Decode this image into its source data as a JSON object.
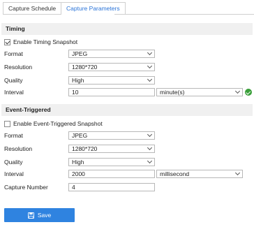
{
  "tabs": [
    {
      "label": "Capture Schedule",
      "active": false
    },
    {
      "label": "Capture Parameters",
      "active": true
    }
  ],
  "timing": {
    "title": "Timing",
    "enable_label": "Enable Timing Snapshot",
    "enabled": true,
    "format": {
      "label": "Format",
      "value": "JPEG"
    },
    "resolution": {
      "label": "Resolution",
      "value": "1280*720"
    },
    "quality": {
      "label": "Quality",
      "value": "High"
    },
    "interval": {
      "label": "Interval",
      "value": "10",
      "unit": "minute(s)",
      "valid": true
    }
  },
  "event": {
    "title": "Event-Triggered",
    "enable_label": "Enable Event-Triggered Snapshot",
    "enabled": false,
    "format": {
      "label": "Format",
      "value": "JPEG"
    },
    "resolution": {
      "label": "Resolution",
      "value": "1280*720"
    },
    "quality": {
      "label": "Quality",
      "value": "High"
    },
    "interval": {
      "label": "Interval",
      "value": "2000",
      "unit": "millisecond"
    },
    "capture_number": {
      "label": "Capture Number",
      "value": "4"
    }
  },
  "save_label": "Save",
  "colors": {
    "accent": "#2f83e0",
    "valid": "#3a9f3a",
    "section_bg": "#f0f0f0"
  }
}
